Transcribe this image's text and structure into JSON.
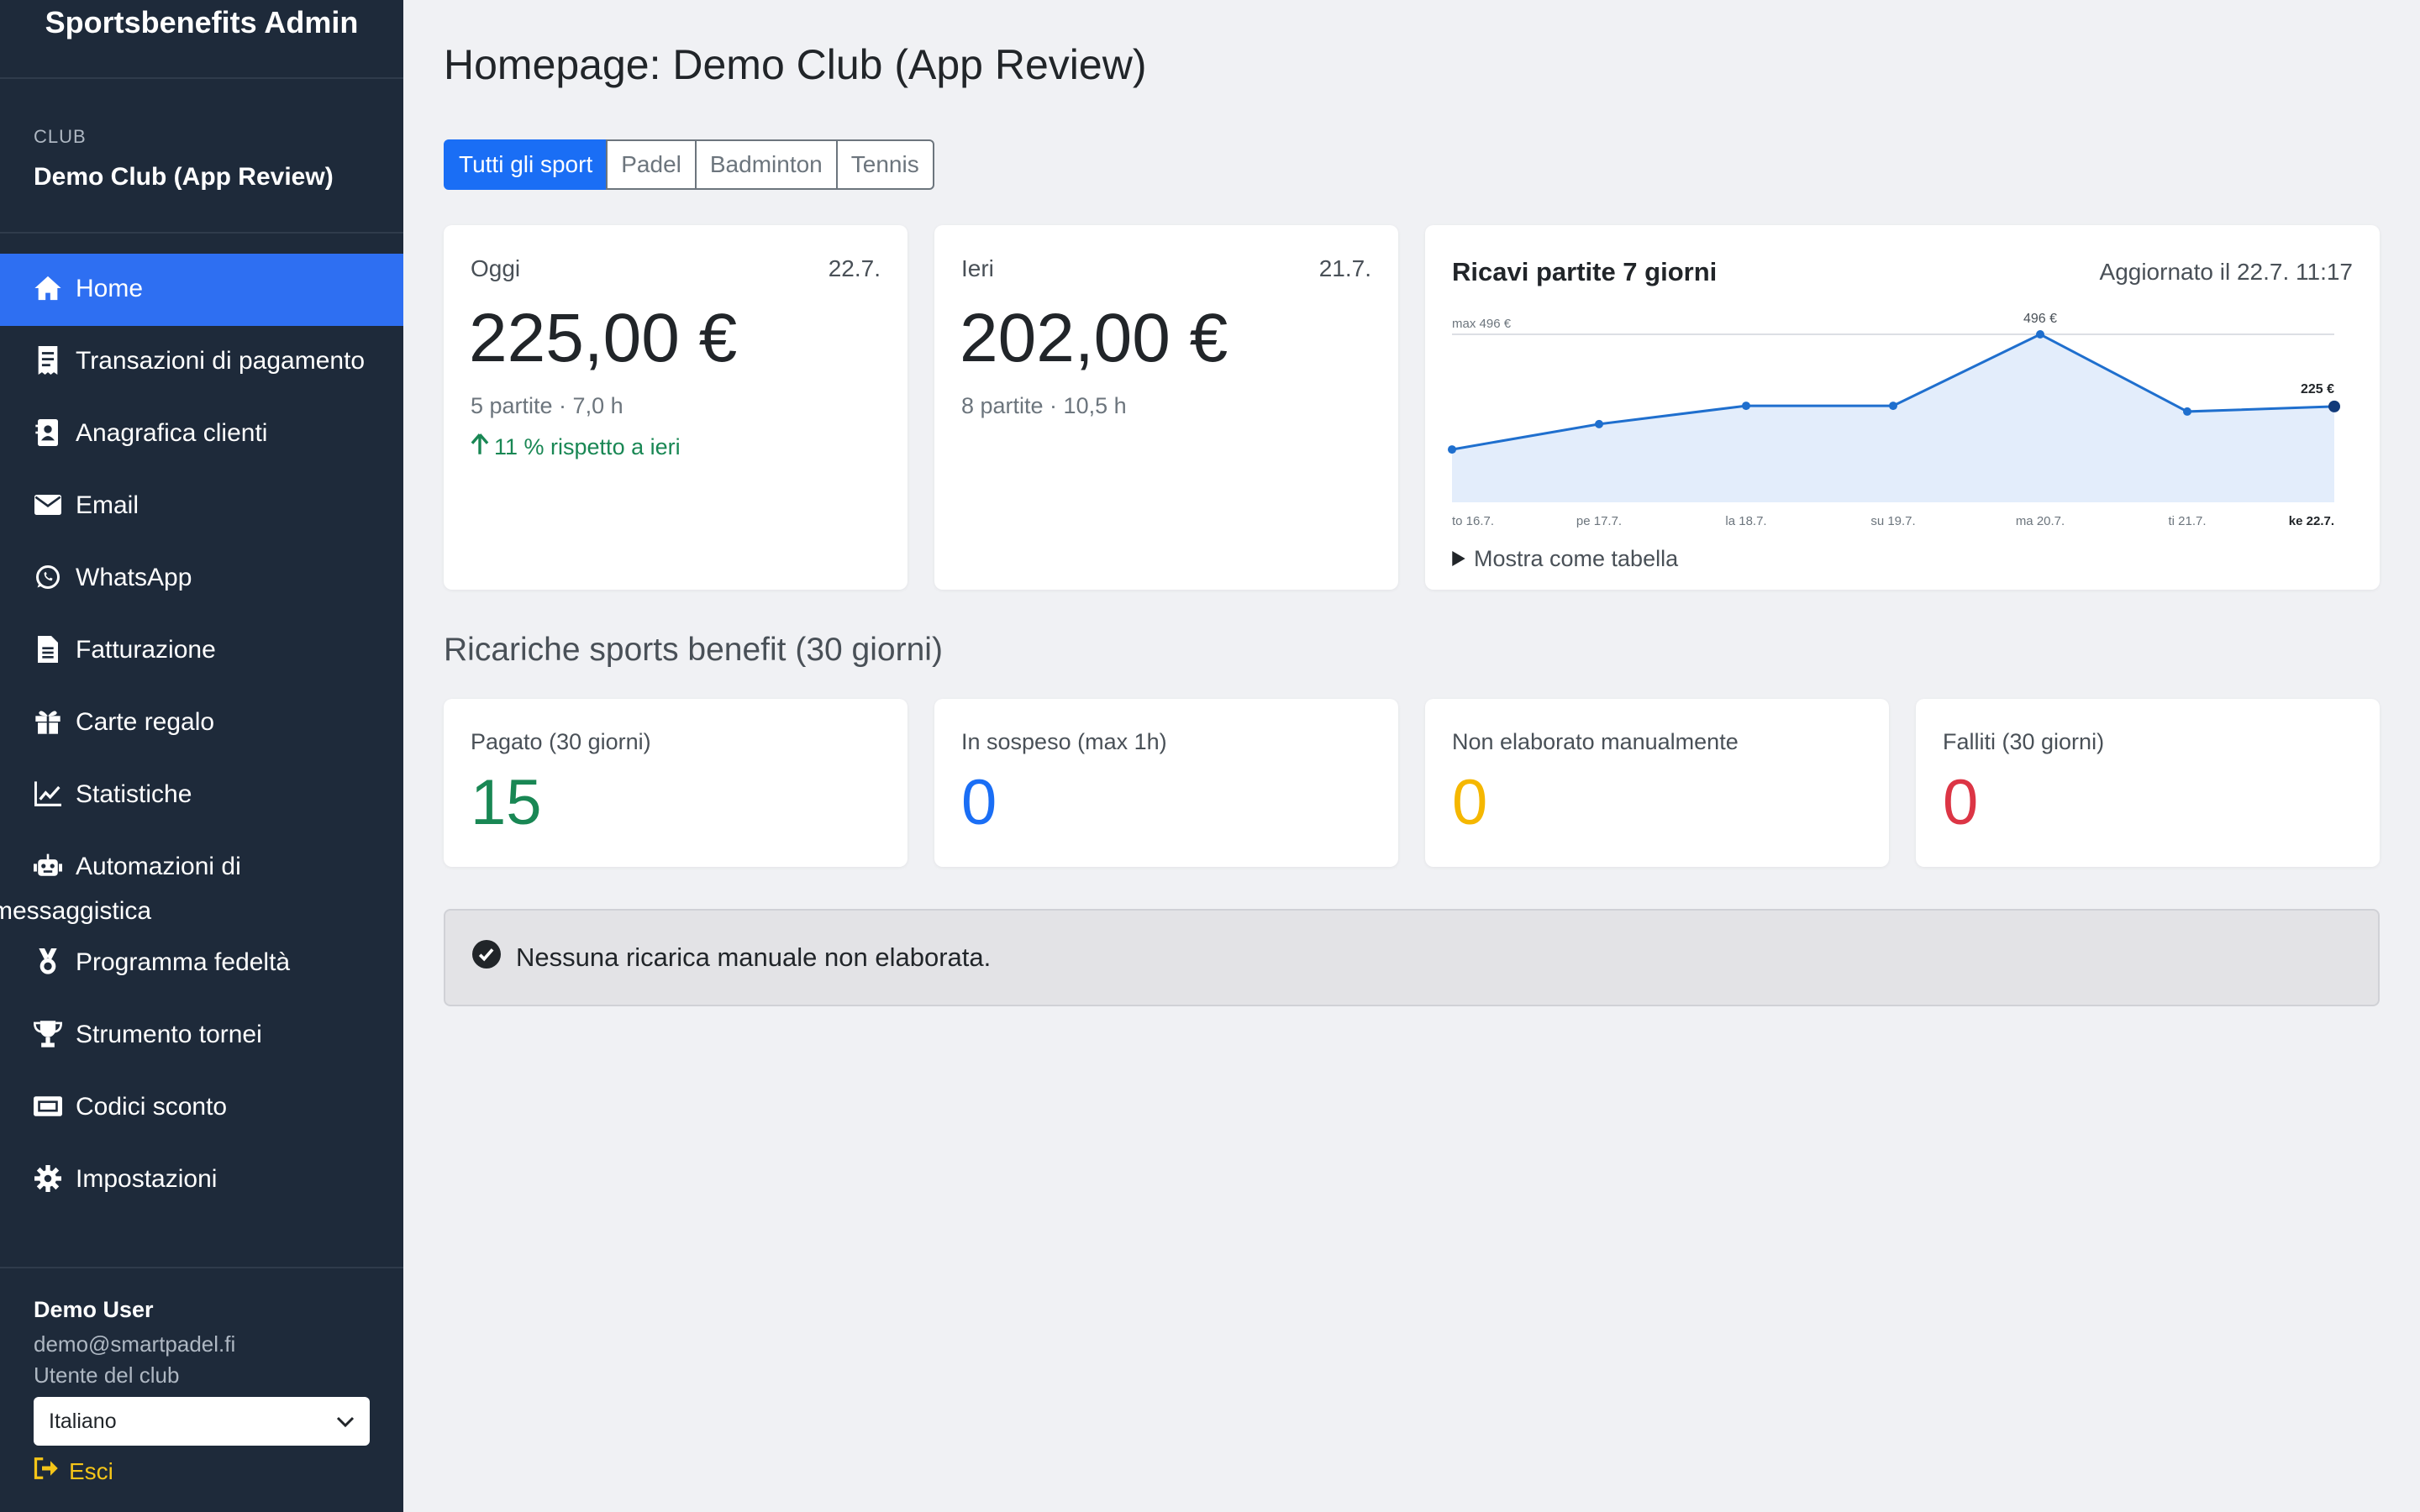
{
  "sidebar": {
    "brand": "Sportsbenefits Admin",
    "club_caption": "CLUB",
    "club_name": "Demo Club (App Review)",
    "items": [
      {
        "label": "Home",
        "icon": "home-icon",
        "active": true
      },
      {
        "label": "Transazioni di pagamento",
        "icon": "receipt-icon"
      },
      {
        "label": "Anagrafica clienti",
        "icon": "contact-card-icon"
      },
      {
        "label": "Email",
        "icon": "envelope-icon"
      },
      {
        "label": "WhatsApp",
        "icon": "whatsapp-icon"
      },
      {
        "label": "Fatturazione",
        "icon": "document-icon"
      },
      {
        "label": "Carte regalo",
        "icon": "gift-icon"
      },
      {
        "label": "Statistiche",
        "icon": "line-chart-icon"
      },
      {
        "label": "Automazioni di",
        "label2": "messaggistica",
        "icon": "robot-icon"
      },
      {
        "label": "Programma fedeltà",
        "icon": "medal-icon"
      },
      {
        "label": "Strumento tornei",
        "icon": "trophy-icon"
      },
      {
        "label": "Codici sconto",
        "icon": "ticket-icon"
      },
      {
        "label": "Impostazioni",
        "icon": "gear-icon"
      }
    ],
    "user": {
      "name": "Demo User",
      "email": "demo@smartpadel.fi",
      "role": "Utente del club",
      "language": "Italiano",
      "logout": "Esci"
    }
  },
  "main": {
    "title": "Homepage: Demo Club (App Review)",
    "tabs": [
      "Tutti gli sport",
      "Padel",
      "Badminton",
      "Tennis"
    ],
    "active_tab": "Tutti gli sport",
    "today": {
      "label": "Oggi",
      "date": "22.7.",
      "amount": "225,00 €",
      "sub": "5 partite · 7,0 h",
      "change": "11 % rispetto a ieri"
    },
    "yesterday": {
      "label": "Ieri",
      "date": "21.7.",
      "amount": "202,00 €",
      "sub": "8 partite · 10,5 h"
    },
    "chart": {
      "title": "Ricavi partite 7 giorni",
      "updated": "Aggiornato il 22.7. 11:17",
      "toggle": "Mostra come tabella"
    },
    "section_title": "Ricariche sports benefit (30 giorni)",
    "kpis": [
      {
        "label": "Pagato (30 giorni)",
        "value": "15",
        "color": "#198754"
      },
      {
        "label": "In sospeso (max 1h)",
        "value": "0",
        "color": "#1a6ef5"
      },
      {
        "label": "Non elaborato manualmente",
        "value": "0",
        "color": "#f5b700"
      },
      {
        "label": "Falliti (30 giorni)",
        "value": "0",
        "color": "#dc3545"
      }
    ],
    "alert": "Nessuna ricarica manuale non elaborata."
  },
  "colors": {
    "sidebar_bg": "#1e2a3a",
    "accent": "#2e6ff2",
    "line": "#1f6fce",
    "area": "#e3edfb"
  },
  "chart_data": {
    "type": "area",
    "categories": [
      "to 16.7.",
      "pe 17.7.",
      "la 18.7.",
      "su 19.7.",
      "ma 20.7.",
      "ti 21.7.",
      "ke 22.7."
    ],
    "values": [
      156,
      231,
      285,
      285,
      496,
      268,
      283
    ],
    "max_label": "max 496 €",
    "peak_label": "496 €",
    "last_label": "225 €",
    "ylim": [
      0,
      496
    ]
  }
}
